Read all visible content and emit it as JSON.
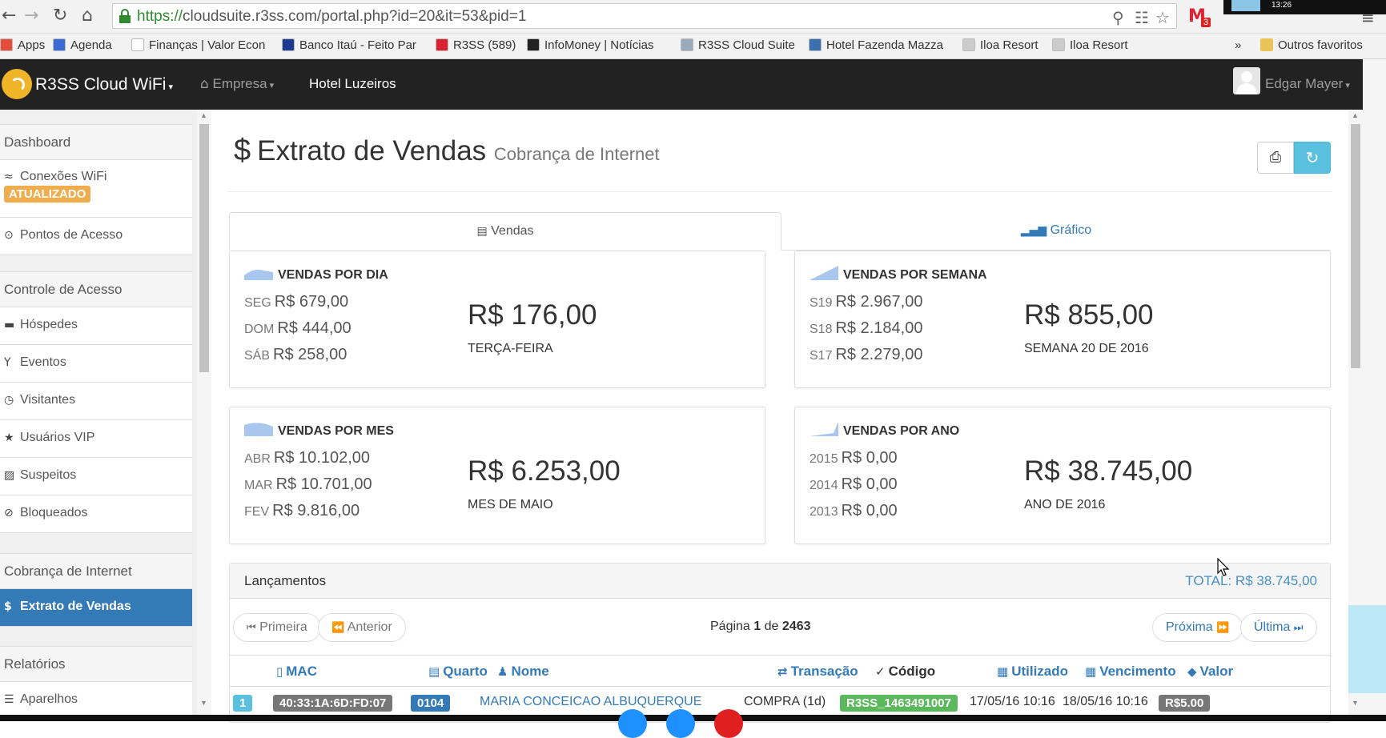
{
  "browser": {
    "url_scheme": "https://",
    "url_rest": "cloudsuite.r3ss.com/portal.php?id=20&it=53&pid=1",
    "gmail_count": "3",
    "clock": "13:26",
    "bookmarks": [
      {
        "label": "Apps",
        "color": "#e74c3c"
      },
      {
        "label": "Agenda",
        "color": "#3b6bd6"
      },
      {
        "label": "Finanças | Valor Econ",
        "color": "#fff"
      },
      {
        "label": "Banco Itaú - Feito Par",
        "color": "#1d3c8f"
      },
      {
        "label": "R3SS (589)",
        "color": "#d23"
      },
      {
        "label": "InfoMoney | Notícias",
        "color": "#222"
      },
      {
        "label": "R3SS Cloud Suite",
        "color": "#9ab"
      },
      {
        "label": "Hotel Fazenda Mazza",
        "color": "#3a6fb0"
      },
      {
        "label": "Iloa Resort",
        "color": "#ccc"
      },
      {
        "label": "Iloa Resort",
        "color": "#ccc"
      }
    ],
    "bookmarks_more": "»",
    "other_bookmarks": "Outros favoritos"
  },
  "navbar": {
    "brand": "R3SS Cloud WiFi",
    "empresa": "Empresa",
    "hotel": "Hotel Luzeiros",
    "user": "Edgar Mayer"
  },
  "sidebar": {
    "dashboard": "Dashboard",
    "conexoes": "Conexões WiFi",
    "atualizado": "ATUALIZADO",
    "pontos": "Pontos de Acesso",
    "controle": "Controle de Acesso",
    "hospedes": "Hóspedes",
    "eventos": "Eventos",
    "visitantes": "Visitantes",
    "vip": "Usuários VIP",
    "suspeitos": "Suspeitos",
    "bloqueados": "Bloqueados",
    "cobranca": "Cobrança de Internet",
    "extrato": "Extrato de Vendas",
    "relatorios": "Relatórios",
    "aparelhos": "Aparelhos"
  },
  "page": {
    "title": "Extrato de Vendas",
    "subtitle": "Cobrança de Internet",
    "tab_vendas": "Vendas",
    "tab_grafico": "Gráfico"
  },
  "panels": {
    "dia": {
      "title": "VENDAS POR DIA",
      "rows": [
        {
          "label": "SEG",
          "value": "R$ 679,00"
        },
        {
          "label": "DOM",
          "value": "R$ 444,00"
        },
        {
          "label": "SÁB",
          "value": "R$ 258,00"
        }
      ],
      "big": "R$ 176,00",
      "sub": "TERÇA-FEIRA"
    },
    "semana": {
      "title": "VENDAS POR SEMANA",
      "rows": [
        {
          "label": "S19",
          "value": "R$ 2.967,00"
        },
        {
          "label": "S18",
          "value": "R$ 2.184,00"
        },
        {
          "label": "S17",
          "value": "R$ 2.279,00"
        }
      ],
      "big": "R$ 855,00",
      "sub": "SEMANA 20 DE 2016"
    },
    "mes": {
      "title": "VENDAS POR MES",
      "rows": [
        {
          "label": "ABR",
          "value": "R$ 10.102,00"
        },
        {
          "label": "MAR",
          "value": "R$ 10.701,00"
        },
        {
          "label": "FEV",
          "value": "R$ 9.816,00"
        }
      ],
      "big": "R$ 6.253,00",
      "sub": "MES DE MAIO"
    },
    "ano": {
      "title": "VENDAS POR ANO",
      "rows": [
        {
          "label": "2015",
          "value": "R$ 0,00"
        },
        {
          "label": "2014",
          "value": "R$ 0,00"
        },
        {
          "label": "2013",
          "value": "R$ 0,00"
        }
      ],
      "big": "R$ 38.745,00",
      "sub": "ANO DE 2016"
    }
  },
  "lancamentos": {
    "title": "Lançamentos",
    "total": "TOTAL: R$ 38.745,00",
    "first": "Primeira",
    "prev": "Anterior",
    "page_label": "Página",
    "page_num": "1",
    "page_of": "de",
    "page_total": "2463",
    "next": "Próxima",
    "last": "Última",
    "columns": {
      "mac": "MAC",
      "quarto": "Quarto",
      "nome": "Nome",
      "transacao": "Transação",
      "codigo": "Código",
      "utilizado": "Utilizado",
      "vencimento": "Vencimento",
      "valor": "Valor"
    },
    "row": {
      "num": "1",
      "mac": "40:33:1A:6D:FD:07",
      "quarto": "0104",
      "nome": "MARIA CONCEICAO ALBUQUERQUE",
      "transacao": "COMPRA (1d)",
      "codigo": "R3SS_1463491007",
      "utilizado": "17/05/16 10:16",
      "vencimento": "18/05/16 10:16",
      "valor": "R$5.00"
    }
  },
  "colors": {
    "navbar": "#222222",
    "primary": "#337ab7",
    "info": "#5bc0de",
    "warning": "#f0ad4e",
    "success": "#5cb85c",
    "dark_label": "#777777"
  }
}
